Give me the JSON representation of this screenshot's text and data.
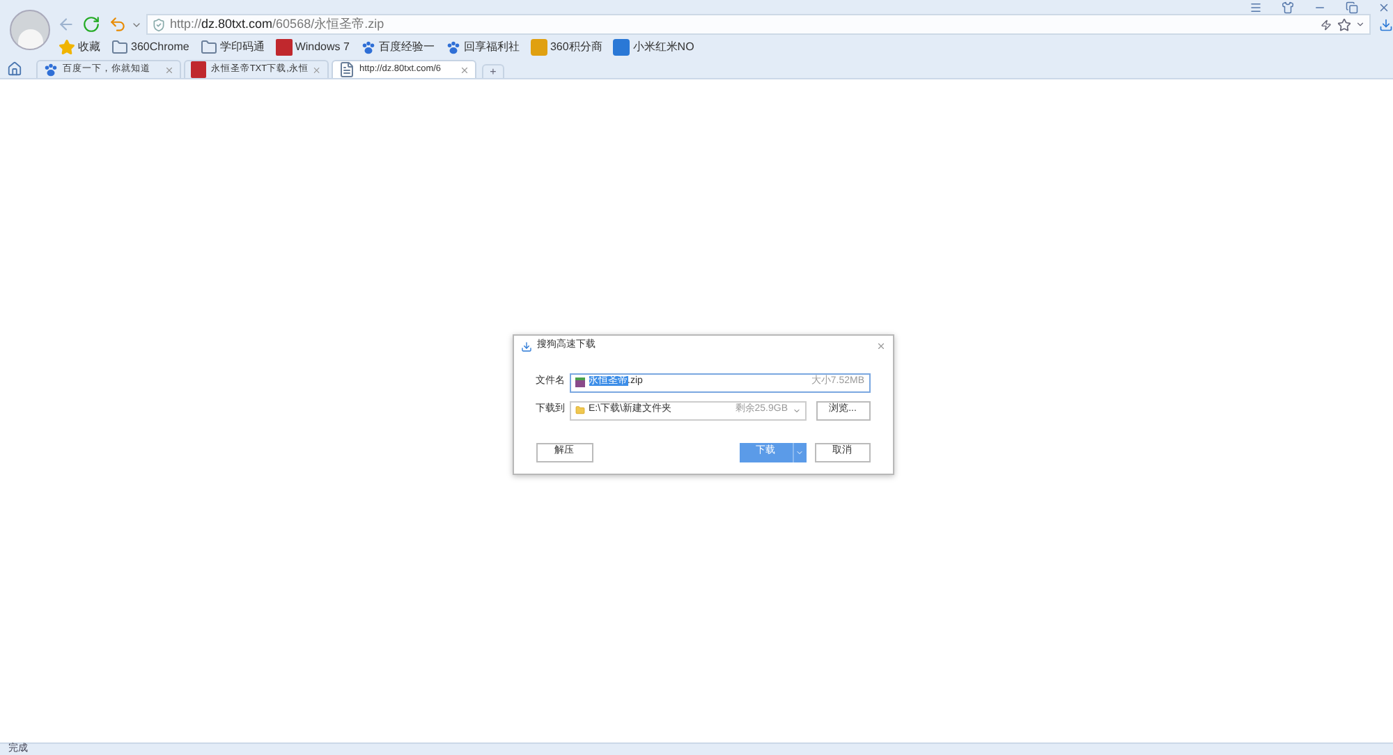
{
  "browser": {
    "url_prefix": "http://",
    "url_host": "dz.80txt.com",
    "url_path": "/60568/永恒圣帝.zip"
  },
  "bookmarks": [
    {
      "label": "收藏",
      "kind": "star"
    },
    {
      "label": "360Chrome",
      "kind": "folder"
    },
    {
      "label": "学印码通",
      "kind": "folder"
    },
    {
      "label": "Windows 7",
      "kind": "txt"
    },
    {
      "label": "百度经验一",
      "kind": "paw"
    },
    {
      "label": "回享福利社",
      "kind": "paw"
    },
    {
      "label": "360积分商",
      "kind": "bag"
    },
    {
      "label": "小米红米NO",
      "kind": "r"
    }
  ],
  "tabs": [
    {
      "label": "百度一下，你就知道",
      "kind": "paw",
      "selected": false
    },
    {
      "label": "永恒圣帝TXT下载,永恒",
      "kind": "txt",
      "selected": false
    },
    {
      "label": "http://dz.80txt.com/6",
      "kind": "page",
      "selected": true
    }
  ],
  "new_tab": "+",
  "dialog": {
    "title": "搜狗高速下载",
    "file_label": "文件名",
    "file_name_selected": "永恒圣帝",
    "file_name_rest": ".zip",
    "file_size": "大小7.52MB",
    "dest_label": "下载到",
    "dest_path": "E:\\下载\\新建文件夹",
    "free_space": "剩余25.9GB",
    "browse": "浏览...",
    "unzip": "解压",
    "download": "下载",
    "cancel": "取消"
  },
  "status_bar": {
    "text": "完成"
  }
}
